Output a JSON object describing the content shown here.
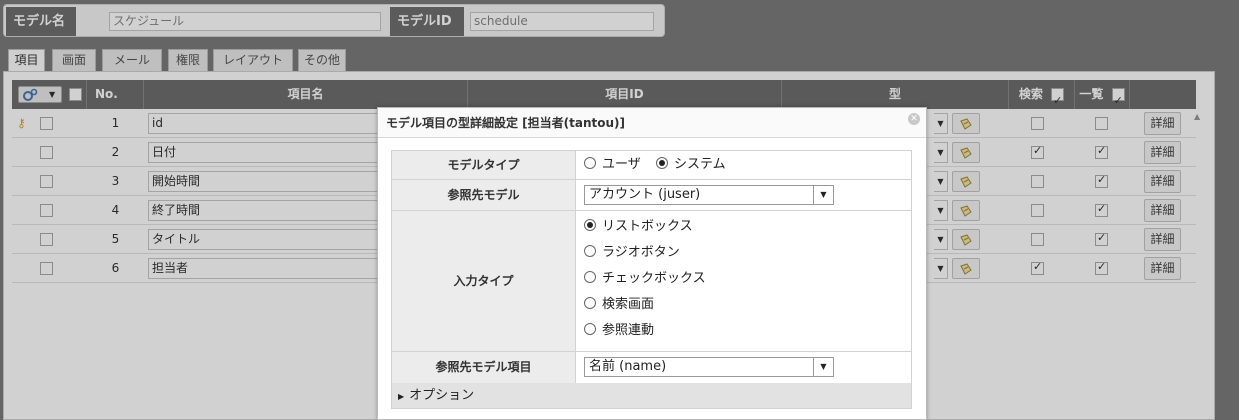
{
  "model": {
    "name_label": "モデル名",
    "name_value": "スケジュール",
    "id_label": "モデルID",
    "id_value": "schedule"
  },
  "tabs": [
    {
      "label": "項目",
      "active": true
    },
    {
      "label": "画面",
      "active": false
    },
    {
      "label": "メール",
      "active": false
    },
    {
      "label": "権限",
      "active": false
    },
    {
      "label": "レイアウト",
      "active": false
    },
    {
      "label": "その他",
      "active": false
    }
  ],
  "table": {
    "headers": {
      "no": "No.",
      "name": "項目名",
      "id": "項目ID",
      "type": "型",
      "search": "検索",
      "list": "一覧"
    },
    "header_search_checked": true,
    "header_list_checked": true,
    "detail_label": "詳細",
    "rows": [
      {
        "no": "1",
        "name": "id",
        "key": true,
        "search": false,
        "list": false
      },
      {
        "no": "2",
        "name": "日付",
        "key": false,
        "search": true,
        "list": true
      },
      {
        "no": "3",
        "name": "開始時間",
        "key": false,
        "search": false,
        "list": true
      },
      {
        "no": "4",
        "name": "終了時間",
        "key": false,
        "search": false,
        "list": true
      },
      {
        "no": "5",
        "name": "タイトル",
        "key": false,
        "search": false,
        "list": true
      },
      {
        "no": "6",
        "name": "担当者",
        "key": false,
        "search": true,
        "list": true
      }
    ]
  },
  "dialog": {
    "title": "モデル項目の型詳細設定 [担当者(tantou)]",
    "model_type": {
      "label": "モデルタイプ",
      "options": [
        {
          "label": "ユーザ",
          "checked": false
        },
        {
          "label": "システム",
          "checked": true
        }
      ]
    },
    "ref_model": {
      "label": "参照先モデル",
      "value": "アカウント (juser)"
    },
    "input_type": {
      "label": "入力タイプ",
      "options": [
        {
          "label": "リストボックス",
          "checked": true
        },
        {
          "label": "ラジオボタン",
          "checked": false
        },
        {
          "label": "チェックボックス",
          "checked": false
        },
        {
          "label": "検索画面",
          "checked": false
        },
        {
          "label": "参照連動",
          "checked": false
        }
      ]
    },
    "ref_item": {
      "label": "参照先モデル項目",
      "value": "名前 (name)"
    },
    "options_label": "オプション"
  },
  "colors": {
    "background": "#7c7c7c",
    "header": "#6e6e6e",
    "label_bg": "#ececec"
  }
}
